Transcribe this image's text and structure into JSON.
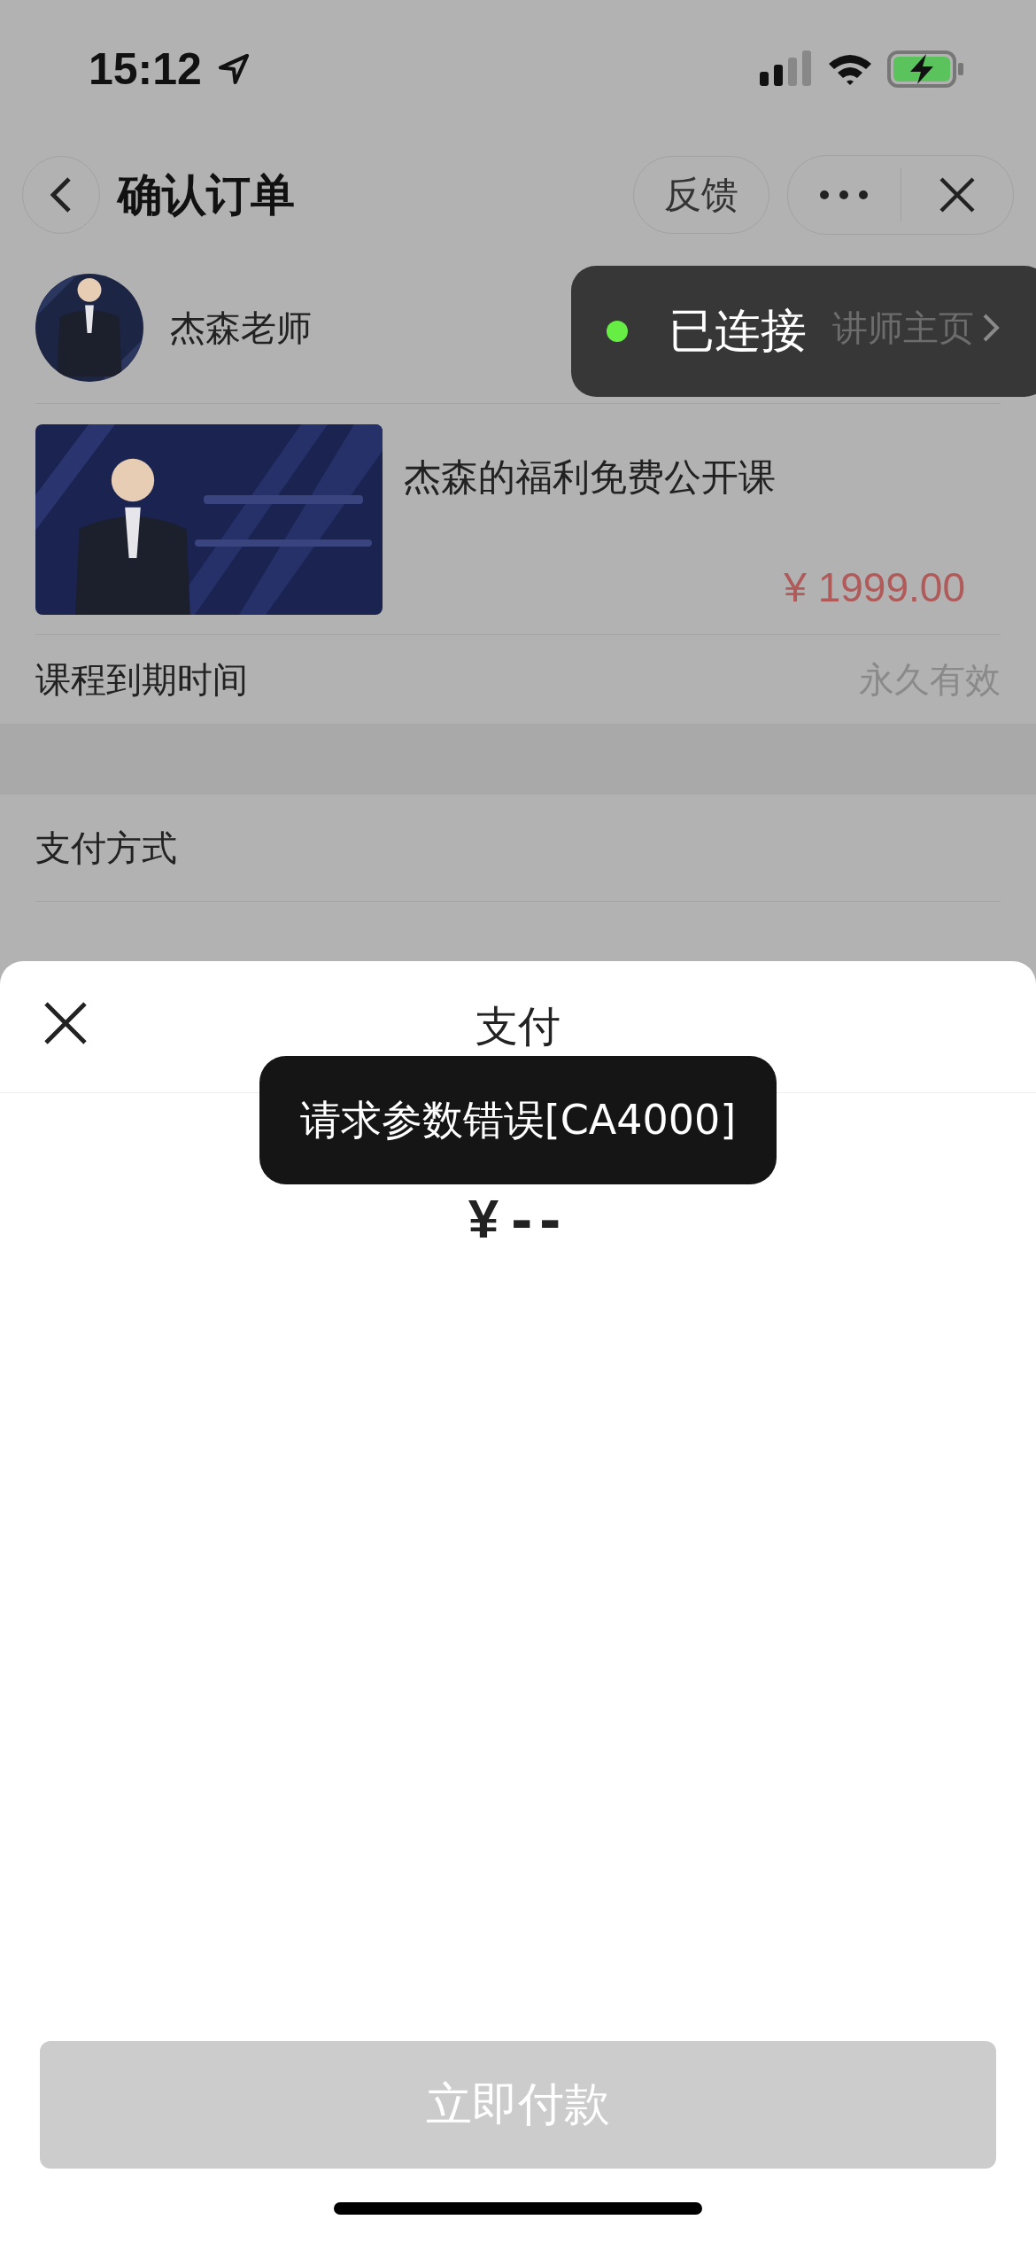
{
  "status_bar": {
    "time": "15:12"
  },
  "nav": {
    "title": "确认订单",
    "feedback": "反馈"
  },
  "teacher": {
    "name": "杰森老师",
    "link": "讲师主页"
  },
  "connection_toast": {
    "text": "已连接",
    "connected": true
  },
  "course": {
    "title": "杰森的福利免费公开课",
    "price": "¥ 1999.00"
  },
  "expiry": {
    "label": "课程到期时间",
    "value": "永久有效"
  },
  "payment_method": {
    "label": "支付方式"
  },
  "sheet": {
    "title": "支付",
    "currency": "¥",
    "amount": "--",
    "error_toast": "请求参数错误[CA4000]",
    "pay_button": {
      "label": "立即付款",
      "disabled": true
    }
  }
}
